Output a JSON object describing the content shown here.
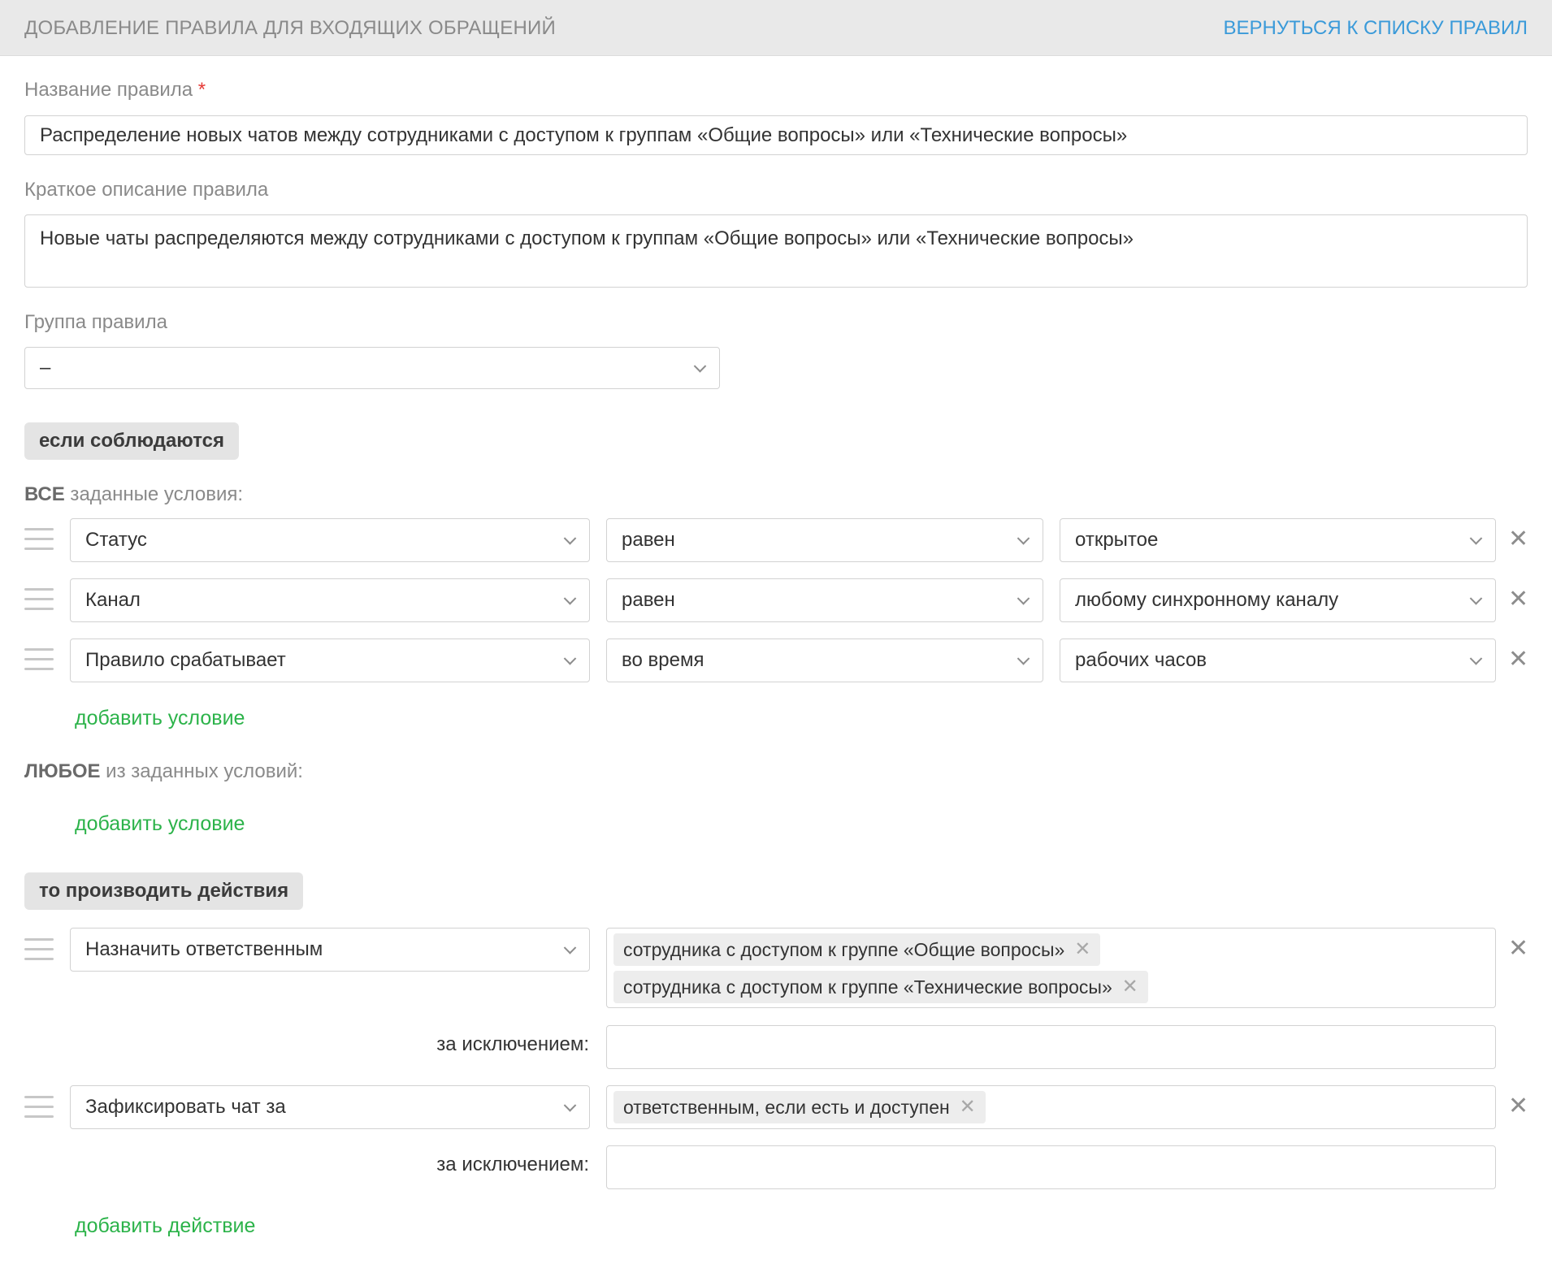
{
  "header": {
    "title": "ДОБАВЛЕНИЕ ПРАВИЛА ДЛЯ ВХОДЯЩИХ ОБРАЩЕНИЙ",
    "back_link": "ВЕРНУТЬСЯ К СПИСКУ ПРАВИЛ"
  },
  "form": {
    "name_label": "Название правила",
    "required_mark": "*",
    "name_value": "Распределение новых чатов между сотрудниками с доступом к группам «Общие вопросы» или «Технические вопросы»",
    "description_label": "Краткое описание правила",
    "description_value": "Новые чаты распределяются между сотрудниками с доступом к группам «Общие вопросы» или «Технические вопросы»",
    "group_label": "Группа правила",
    "group_value": "–"
  },
  "conditions": {
    "section_label": "если соблюдаются",
    "all_heading_bold": "ВСЕ",
    "all_heading_rest": " заданные условия:",
    "all_rows": [
      {
        "field": "Статус",
        "operator": "равен",
        "value": "открытое"
      },
      {
        "field": "Канал",
        "operator": "равен",
        "value": "любому синхронному каналу"
      },
      {
        "field": "Правило срабатывает",
        "operator": "во время",
        "value": "рабочих часов"
      }
    ],
    "add_condition_label": "добавить условие",
    "any_heading_bold": "ЛЮБОЕ",
    "any_heading_rest": " из заданных условий:",
    "add_condition_label_any": "добавить условие"
  },
  "actions": {
    "section_label": "то производить действия",
    "rows": [
      {
        "action": "Назначить ответственным",
        "tags": [
          "сотрудника с доступом к группе «Общие вопросы»",
          "сотрудника с доступом к группе «Технические вопросы»"
        ],
        "except_label": "за исключением:",
        "except_value": ""
      },
      {
        "action": "Зафиксировать чат за",
        "tags": [
          "ответственным, если есть и доступен"
        ],
        "except_label": "за исключением:",
        "except_value": ""
      }
    ],
    "add_action_label": "добавить действие"
  },
  "icons": {
    "remove": "close-icon",
    "drag": "drag-handle-icon",
    "dropdown": "chevron-down-icon",
    "tag_remove": "close-icon"
  },
  "colors": {
    "accent_link": "#3a9ad9",
    "add_link": "#2cb34a",
    "required": "#e53935",
    "header_bg": "#e9e9e9"
  }
}
